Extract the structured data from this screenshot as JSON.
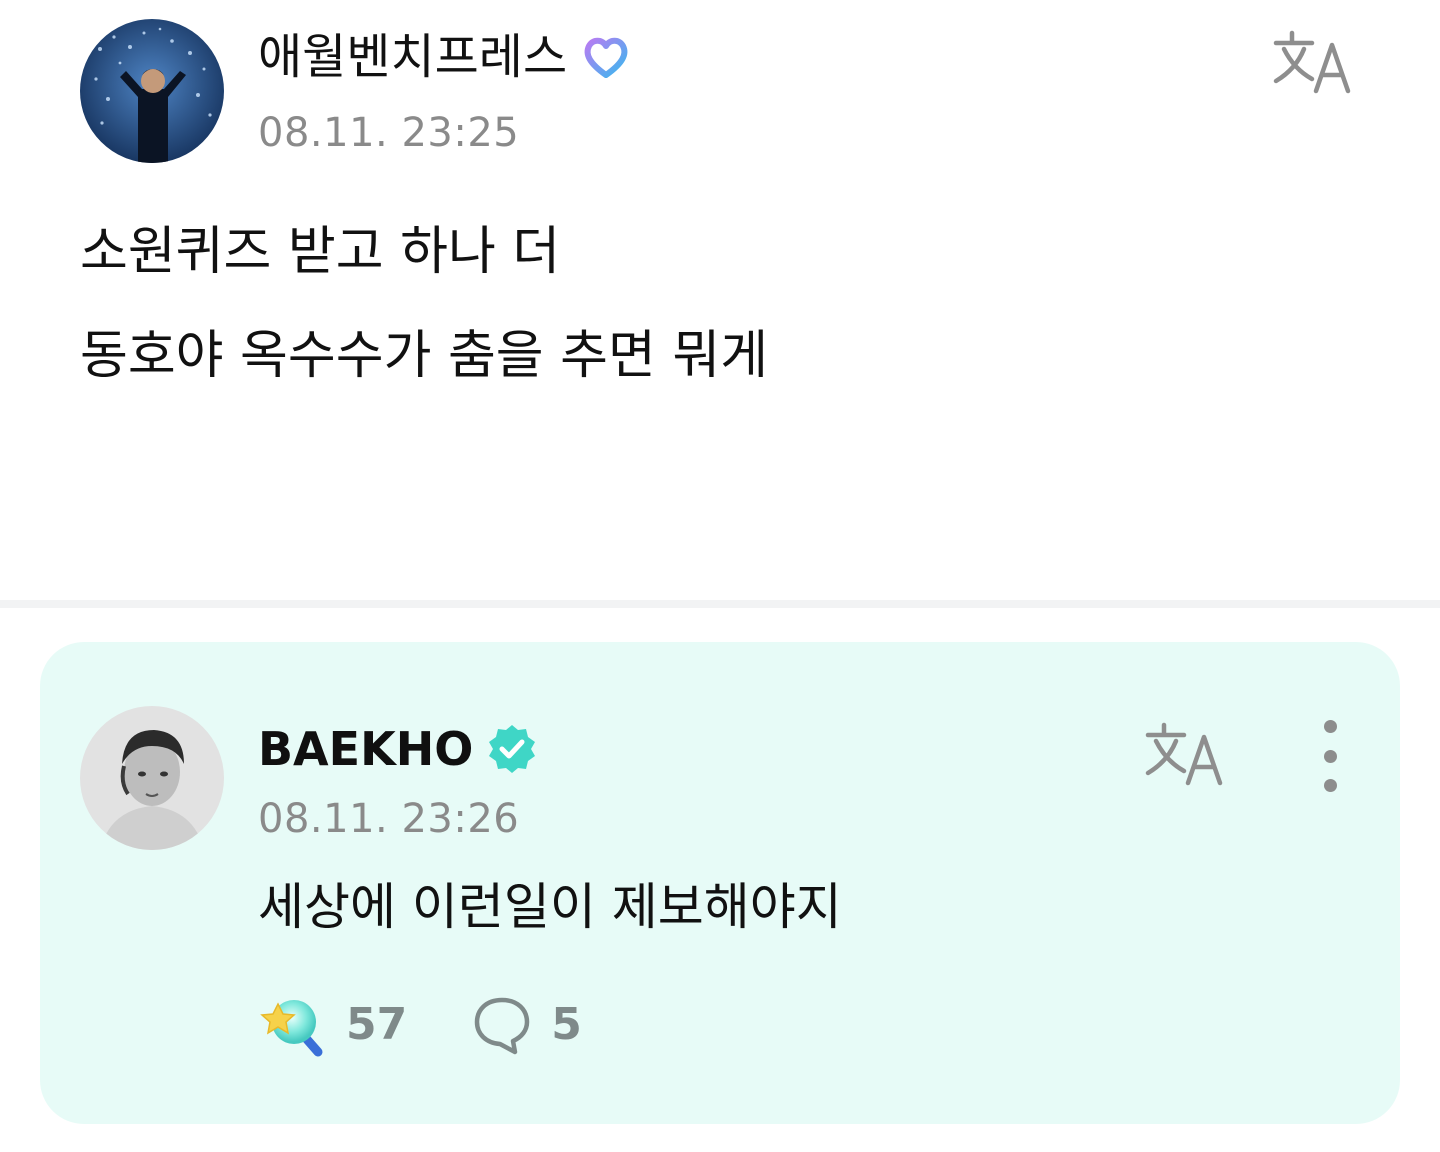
{
  "post": {
    "author": "애월벤치프레스",
    "badge_icon": "fan-membership-heart-icon",
    "timestamp": "08.11. 23:25",
    "translate_icon": "translate-icon",
    "body_lines": [
      "소원퀴즈 받고 하나 더",
      "동호야 옥수수가 춤을 추면 뭐게"
    ]
  },
  "comment": {
    "author": "BAEKHO",
    "badge_icon": "verified-check-icon",
    "timestamp": "08.11. 23:26",
    "translate_icon": "translate-icon",
    "more_icon": "more-vertical-icon",
    "body": "세상에 이런일이 제보해야지",
    "like_icon": "star-lightstick-icon",
    "like_count": "57",
    "comment_icon": "comment-bubble-icon",
    "comment_count": "5"
  },
  "colors": {
    "card_background": "#e7fbf7",
    "verified_badge": "#3fd6c6",
    "timestamp_gray": "#8a8a8a",
    "separator": "#f2f3f4"
  }
}
